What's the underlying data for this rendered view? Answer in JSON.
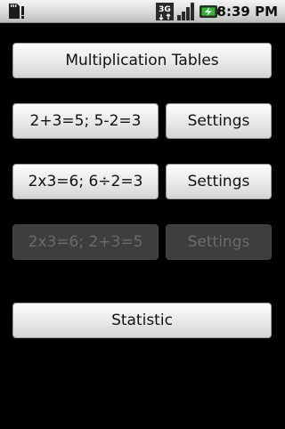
{
  "status_bar": {
    "time": "8:39 PM",
    "network_label": "3G",
    "icons": [
      "sd-card-warning-icon",
      "3g-data-icon",
      "signal-strength-icon",
      "battery-charging-icon"
    ]
  },
  "buttons": {
    "multiplication_tables": "Multiplication Tables",
    "add_sub": "2+3=5; 5-2=3",
    "add_sub_settings": "Settings",
    "mul_div": "2x3=6; 6÷2=3",
    "mul_div_settings": "Settings",
    "mul_add": "2x3=6; 2+3=5",
    "mul_add_settings": "Settings",
    "statistic": "Statistic"
  },
  "colors": {
    "background": "#000000",
    "button_light": "#ececec",
    "button_disabled": "#3e3e3e",
    "battery_accent": "#2db82d"
  }
}
